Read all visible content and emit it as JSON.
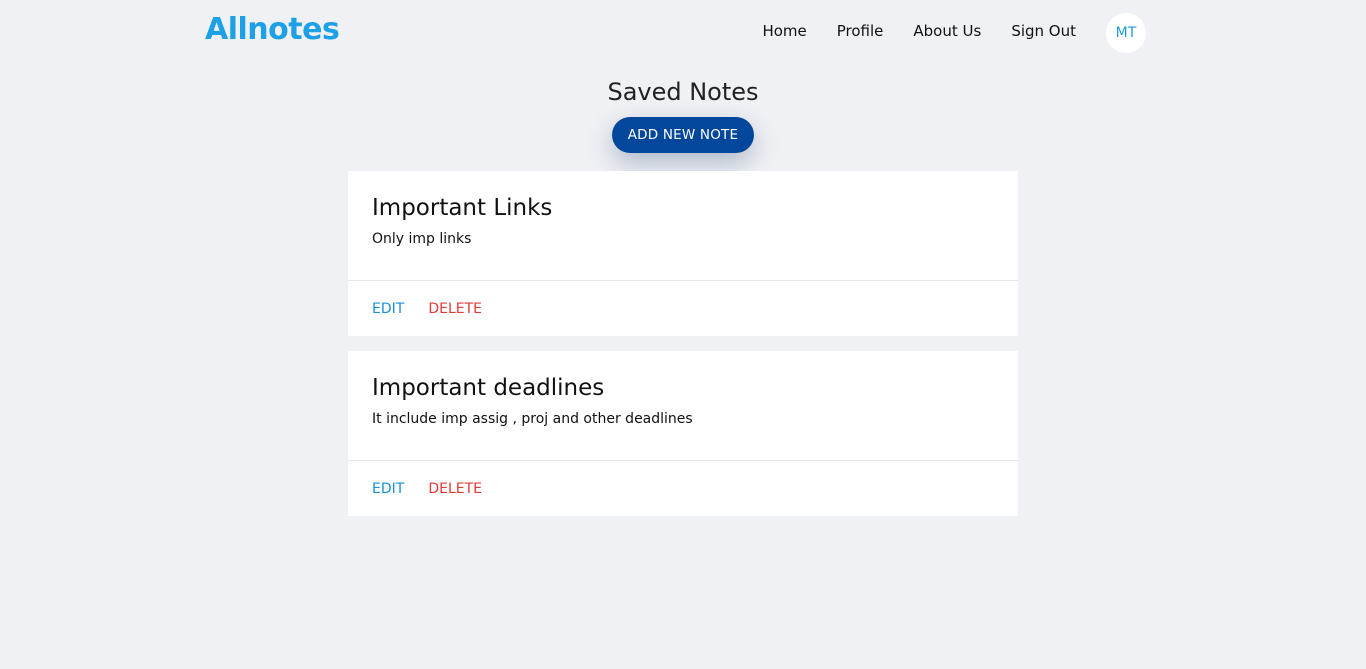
{
  "brand": "Allnotes",
  "nav": {
    "links": [
      "Home",
      "Profile",
      "About Us",
      "Sign Out"
    ],
    "avatar_initials": "MT"
  },
  "page": {
    "title": "Saved Notes",
    "add_button_label": "ADD NEW NOTE"
  },
  "notes": [
    {
      "title": "Important Links",
      "description": "Only imp links",
      "edit_label": "EDIT",
      "delete_label": "DELETE"
    },
    {
      "title": "Important deadlines",
      "description": "It include imp assig , proj and other deadlines",
      "edit_label": "EDIT",
      "delete_label": "DELETE"
    }
  ],
  "colors": {
    "brand": "#1ea0e6",
    "primary_button": "#02479b",
    "edit": "#1a8fd8",
    "delete": "#e53935",
    "background": "#f0f1f5"
  }
}
